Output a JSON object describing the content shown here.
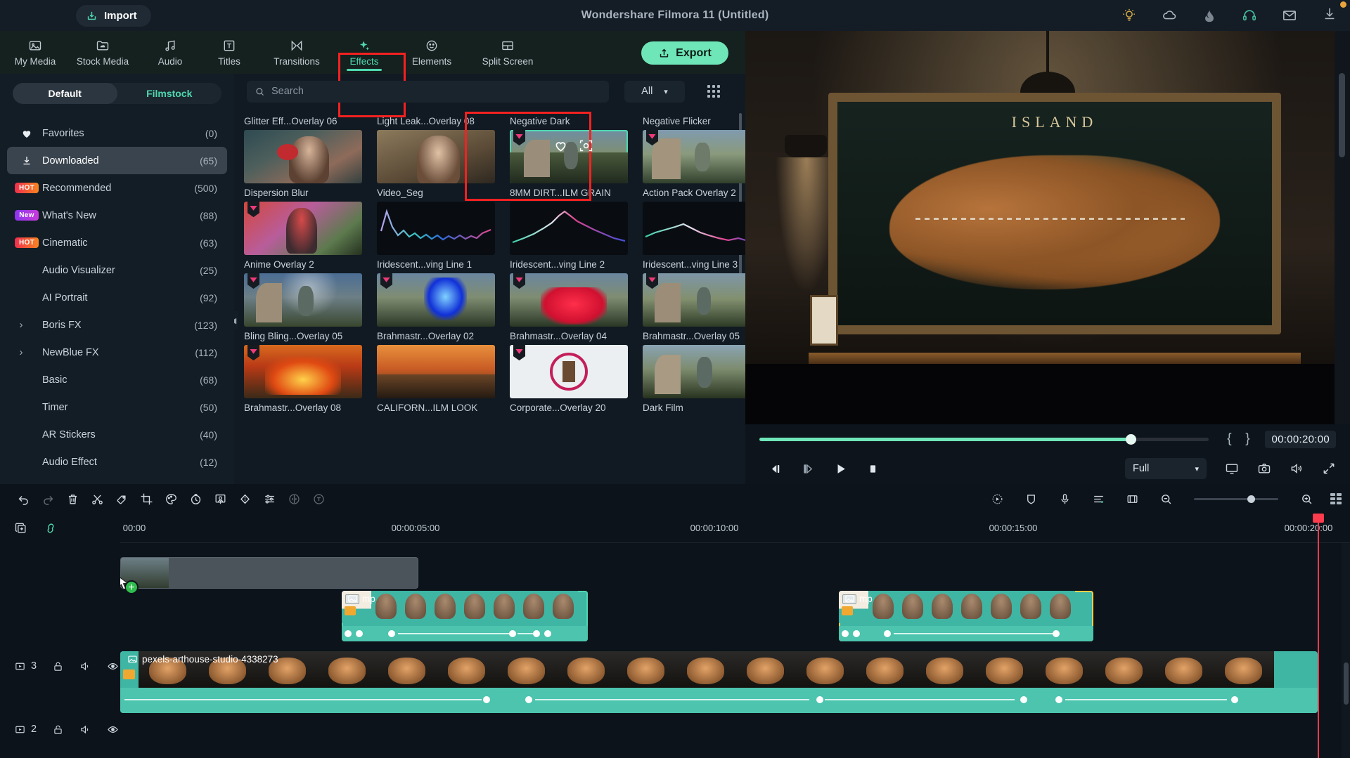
{
  "titlebar": {
    "import_label": "Import",
    "window_title": "Wondershare Filmora 11 (Untitled)",
    "icons": [
      "tips-bulb-icon",
      "cloud-icon",
      "flame-icon",
      "headset-support-icon",
      "mail-icon",
      "download-icon"
    ]
  },
  "tabs": [
    {
      "label": "My Media",
      "icon": "image-icon",
      "active": false
    },
    {
      "label": "Stock Media",
      "icon": "folder-cloud-icon",
      "active": false
    },
    {
      "label": "Audio",
      "icon": "music-note-icon",
      "active": false
    },
    {
      "label": "Titles",
      "icon": "text-box-icon",
      "active": false
    },
    {
      "label": "Transitions",
      "icon": "transition-icon",
      "active": false
    },
    {
      "label": "Effects",
      "icon": "sparkle-icon",
      "active": true
    },
    {
      "label": "Elements",
      "icon": "smiley-sticker-icon",
      "active": false
    },
    {
      "label": "Split Screen",
      "icon": "split-screen-icon",
      "active": false
    }
  ],
  "export": {
    "label": "Export"
  },
  "segmented": {
    "default_label": "Default",
    "filmstock_label": "Filmstock",
    "selected": "Default"
  },
  "categories": [
    {
      "label": "Favorites",
      "count": "(0)",
      "icon": "heart-icon",
      "badge": null,
      "expandable": false,
      "selected": false
    },
    {
      "label": "Downloaded",
      "count": "(65)",
      "icon": "download-icon",
      "badge": null,
      "expandable": false,
      "selected": true
    },
    {
      "label": "Recommended",
      "count": "(500)",
      "icon": null,
      "badge": "HOT",
      "expandable": false,
      "selected": false
    },
    {
      "label": "What's New",
      "count": "(88)",
      "icon": null,
      "badge": "New",
      "expandable": false,
      "selected": false
    },
    {
      "label": "Cinematic",
      "count": "(63)",
      "icon": null,
      "badge": "HOT",
      "expandable": false,
      "selected": false
    },
    {
      "label": "Audio Visualizer",
      "count": "(25)",
      "icon": null,
      "badge": null,
      "expandable": false,
      "selected": false
    },
    {
      "label": "AI Portrait",
      "count": "(92)",
      "icon": null,
      "badge": null,
      "expandable": false,
      "selected": false
    },
    {
      "label": "Boris FX",
      "count": "(123)",
      "icon": null,
      "badge": null,
      "expandable": true,
      "selected": false
    },
    {
      "label": "NewBlue FX",
      "count": "(112)",
      "icon": null,
      "badge": null,
      "expandable": true,
      "selected": false
    },
    {
      "label": "Basic",
      "count": "(68)",
      "icon": null,
      "badge": null,
      "expandable": false,
      "selected": false
    },
    {
      "label": "Timer",
      "count": "(50)",
      "icon": null,
      "badge": null,
      "expandable": false,
      "selected": false
    },
    {
      "label": "AR Stickers",
      "count": "(40)",
      "icon": null,
      "badge": null,
      "expandable": false,
      "selected": false
    },
    {
      "label": "Audio Effect",
      "count": "(12)",
      "icon": null,
      "badge": null,
      "expandable": false,
      "selected": false
    }
  ],
  "search": {
    "placeholder": "Search",
    "value": ""
  },
  "filter": {
    "label": "All"
  },
  "effects": [
    {
      "name": "Glitter Eff...Overlay 06",
      "gem": false,
      "selected": false,
      "thumb": "girl-red-flower"
    },
    {
      "name": "Light Leak...Overlay 08",
      "gem": false,
      "selected": false,
      "thumb": "woman-portrait"
    },
    {
      "name": "Negative Dark",
      "gem": true,
      "selected": true,
      "thumb": "couple-field"
    },
    {
      "name": "Negative Flicker",
      "gem": true,
      "selected": false,
      "thumb": "couple-field2"
    },
    {
      "name": "Dispersion Blur",
      "gem": true,
      "selected": false,
      "thumb": "red-dispersion"
    },
    {
      "name": "Video_Seg",
      "gem": false,
      "selected": false,
      "thumb": "wave-line-1"
    },
    {
      "name": "8MM DIRT...ILM GRAIN",
      "gem": false,
      "selected": false,
      "thumb": "wave-line-2"
    },
    {
      "name": "Action Pack Overlay 2",
      "gem": true,
      "selected": false,
      "thumb": "wave-line-3"
    },
    {
      "name": "Anime Overlay 2",
      "gem": true,
      "selected": false,
      "thumb": "bling-sky"
    },
    {
      "name": "Iridescent...ving Line 1",
      "gem": true,
      "selected": false,
      "thumb": "blue-flame"
    },
    {
      "name": "Iridescent...ving Line 2",
      "gem": true,
      "selected": false,
      "thumb": "red-smoke"
    },
    {
      "name": "Iridescent...ving Line 3",
      "gem": true,
      "selected": false,
      "thumb": "field-green"
    },
    {
      "name": "Bling Bling...Overlay 05",
      "gem": true,
      "selected": false,
      "thumb": "fire-orange"
    },
    {
      "name": "Brahmastr...Overlay 02",
      "gem": false,
      "selected": false,
      "thumb": "sunset-field"
    },
    {
      "name": "Brahmastr...Overlay 04",
      "gem": true,
      "selected": false,
      "thumb": "corporate-logo"
    },
    {
      "name": "Brahmastr...Overlay 05",
      "gem": false,
      "selected": false,
      "thumb": "dark-field"
    },
    {
      "name": "Brahmastr...Overlay 08",
      "gem": false,
      "selected": false,
      "thumb": ""
    },
    {
      "name": "CALIFORN...ILM LOOK",
      "gem": false,
      "selected": false,
      "thumb": ""
    },
    {
      "name": "Corporate...Overlay 20",
      "gem": false,
      "selected": false,
      "thumb": ""
    },
    {
      "name": "Dark Film",
      "gem": false,
      "selected": false,
      "thumb": ""
    }
  ],
  "player": {
    "progress_percent": 82.5,
    "timecode": "00:00:20:00",
    "mark_in": "{",
    "mark_out": "}",
    "quality_label": "Full",
    "buttons": [
      "prev-frame-icon",
      "next-frame-icon",
      "play-icon",
      "stop-icon"
    ],
    "right_icons": [
      "monitor-icon",
      "snapshot-camera-icon",
      "speaker-icon",
      "fullscreen-icon"
    ]
  },
  "timeline": {
    "tools": [
      "undo-icon",
      "redo-icon",
      "delete-icon",
      "split-scissors-icon",
      "marker-tag-icon",
      "crop-icon",
      "color-palette-icon",
      "speed-clock-icon",
      "green-screen-icon",
      "mask-icon",
      "audio-mixer-icon",
      "audio-detach-icon",
      "render-preview-icon"
    ],
    "right_tools": [
      "record-voice-playback-icon",
      "shield-icon",
      "microphone-icon",
      "audio-mixer-icon",
      "marker-icon",
      "zoom-out-icon",
      "zoom-in-icon",
      "grid-view-icon"
    ],
    "head_tools": [
      "add-track-icon",
      "link-unlink-icon"
    ],
    "ruler_labels": [
      "00:00",
      "00:00:05:00",
      "00:00:10:00",
      "00:00:15:00",
      "00:00:20:00"
    ],
    "tracks": [
      {
        "number": "3",
        "lock": "unlock-icon",
        "audio": "speaker-icon",
        "eye": "eye-icon"
      },
      {
        "number": "2",
        "lock": "unlock-icon",
        "audio": "speaker-icon",
        "eye": "eye-icon"
      }
    ],
    "clips": [
      {
        "track": "overlay",
        "label": "",
        "kind": "gray-placeholder"
      },
      {
        "track": "3",
        "label": "mp",
        "kind": "teal-media"
      },
      {
        "track": "3b",
        "label": "mp",
        "kind": "teal-media-selected"
      },
      {
        "track": "2",
        "label": "pexels-arthouse-studio-4338273",
        "kind": "teal-media"
      }
    ]
  }
}
